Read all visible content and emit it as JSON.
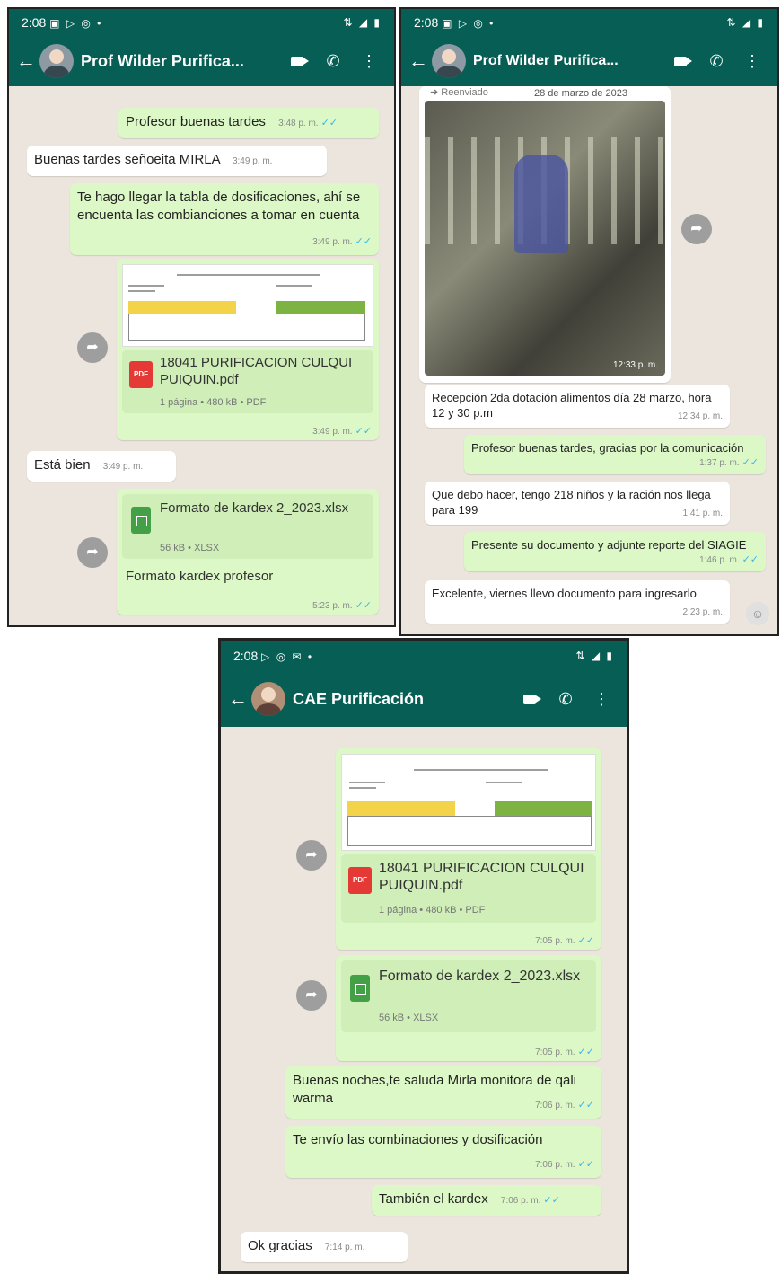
{
  "phone1": {
    "status_time": "2:08",
    "status_icons": "▣ ▷ ◎ •",
    "status_right": "⇅ ◢ ▮",
    "contact": "Prof Wilder Purifica...",
    "messages": [
      {
        "text": "Profesor buenas tardes",
        "time": "3:48 p. m."
      },
      {
        "text": "Buenas tardes señoeita MIRLA",
        "time": "3:49 p. m."
      },
      {
        "text": "Te hago llegar la tabla de dosificaciones, ahí se encuenta las combianciones a tomar en cuenta",
        "time": "3:49 p. m."
      },
      {
        "text": "Está bien",
        "time": "3:49 p. m."
      },
      {
        "text": "Formato kardex profesor",
        "time": "5:23 p. m."
      }
    ],
    "pdf": {
      "name": "18041 PURIFICACION CULQUI PUIQUIN.pdf",
      "meta": "1 página • 480 kB • PDF",
      "time": "3:49 p. m."
    },
    "xlsx": {
      "name": "Formato de kardex 2_2023.xlsx",
      "meta": "56 kB • XLSX"
    }
  },
  "phone2": {
    "status_time": "2:08",
    "status_icons": "▣ ▷ ◎ •",
    "status_right": "⇅ ◢ ▮",
    "contact": "Prof Wilder Purifica...",
    "forwarded": "➜ Reenviado",
    "date_chip": "28 de marzo de 2023",
    "photo_time": "12:33 p. m.",
    "messages": [
      {
        "text": "Recepción 2da dotación alimentos día 28 marzo, hora 12 y 30 p.m",
        "time": "12:34 p. m."
      },
      {
        "text": "Profesor buenas tardes, gracias por la comunicación",
        "time": "1:37 p. m."
      },
      {
        "text": "Que debo hacer, tengo 218 niños y la ración nos llega para 199",
        "time": "1:41 p. m."
      },
      {
        "text": "Presente su documento y adjunte reporte del SIAGIE",
        "time": "1:46 p. m."
      },
      {
        "text": "Excelente, viernes llevo documento para ingresarlo",
        "time": "2:23 p. m."
      }
    ]
  },
  "phone3": {
    "status_time": "2:08",
    "status_icons": "▷ ◎ ✉ •",
    "status_right": "⇅ ◢ ▮",
    "contact": "CAE Purificación",
    "pdf": {
      "name": "18041 PURIFICACION CULQUI PUIQUIN.pdf",
      "meta": "1 página • 480 kB • PDF",
      "time": "7:05 p. m."
    },
    "xlsx": {
      "name": "Formato de kardex 2_2023.xlsx",
      "meta": "56 kB • XLSX",
      "time": "7:05 p. m."
    },
    "messages": [
      {
        "text": "Buenas noches,te saluda Mirla monitora de qali warma",
        "time": "7:06 p. m."
      },
      {
        "text": "Te envío las combinaciones y dosificación",
        "time": "7:06 p. m."
      },
      {
        "text": "También el kardex",
        "time": "7:06 p. m."
      },
      {
        "text": "Ok gracias",
        "time": "7:14 p. m."
      }
    ]
  },
  "icons": {
    "back": "←",
    "call": "✆",
    "menu": "⋮",
    "forward": "➦",
    "ticks": "✓✓",
    "pdf_badge": "PDF",
    "emoji": "☺"
  },
  "colors": {
    "header": "#075e54",
    "outgoing": "#dcf8c6",
    "incoming": "#ffffff",
    "chat_bg": "#ece5dd",
    "read_ticks": "#34b7f1"
  }
}
